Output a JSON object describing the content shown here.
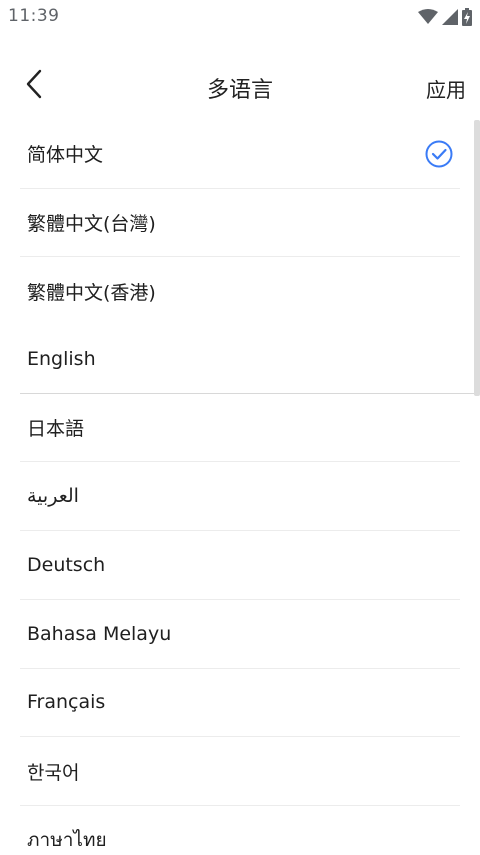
{
  "status_bar": {
    "time": "11:39",
    "icons": [
      "wifi-icon",
      "signal-icon",
      "battery-charging-icon"
    ]
  },
  "app_bar": {
    "back_icon": "chevron-left-icon",
    "title": "多语言",
    "apply_label": "应用"
  },
  "languages": {
    "items": [
      {
        "label": "简体中文",
        "selected": true
      },
      {
        "label": "繁體中文(台灣)",
        "selected": false
      },
      {
        "label": "繁體中文(香港)",
        "selected": false
      },
      {
        "label": "English",
        "selected": false
      },
      {
        "label": "日本語",
        "selected": false
      },
      {
        "label": "العربية",
        "selected": false
      },
      {
        "label": "Deutsch",
        "selected": false
      },
      {
        "label": "Bahasa Melayu",
        "selected": false
      },
      {
        "label": "Français",
        "selected": false
      },
      {
        "label": "한국어",
        "selected": false
      },
      {
        "label": "ภาษาไทย",
        "selected": false
      }
    ]
  },
  "colors": {
    "accent": "#3a7bf6",
    "text": "#1f1f1f",
    "divider": "#ececec"
  }
}
